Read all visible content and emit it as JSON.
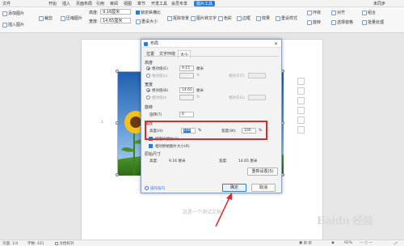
{
  "menubar": {
    "items": [
      "文件",
      "开始",
      "插入",
      "页面布局",
      "引用",
      "审阅",
      "视图",
      "章节",
      "开发工具",
      "会员专享",
      "图片工具"
    ],
    "active": "图片工具",
    "right_label": "未同步"
  },
  "ribbon": {
    "add_picture": "添加图片",
    "crop": "裁剪",
    "compress": "压缩图片",
    "insert_pic": "插入图片",
    "clear_bg": "抠除背景",
    "height_label": "高度:",
    "height_value": "9.16厘米",
    "width_label": "宽度:",
    "width_value": "14.65厘米",
    "lock_ratio": "锁定纵横比",
    "reset_size": "重设大小",
    "reset_style": "重设样式",
    "effects": "效果",
    "color": "色彩",
    "outline": "边框",
    "wrap": "环绕",
    "rotate": "旋转",
    "align": "对齐",
    "select": "选择窗格",
    "combine": "组合",
    "text_extract": "图片转文字",
    "batch": "批量处理",
    "more": "更多"
  },
  "document": {
    "caption": "这是一个测试文档"
  },
  "dialog": {
    "title": "布局",
    "tabs": [
      "位置",
      "文字环绕",
      "大小"
    ],
    "selected_tab": "大小",
    "height_section": "高度",
    "absolute_label": "绝对值(E)",
    "height_abs_value": "9.15",
    "unit_cm": "厘米",
    "relative_label": "相对值(L)",
    "relative_to": "相对于(T)",
    "percent": "%",
    "width_section": "宽度",
    "width_abs_label": "绝对值(B)",
    "width_abs_value": "14.65",
    "width_rel_label": "相对值(I)",
    "width_rel_to": "相对于(E)",
    "rotate_section": "旋转",
    "rotate_label": "旋转(T)",
    "rotate_value": "0",
    "scale_section": "缩放",
    "scale_height_label": "高度(H):",
    "scale_height_value": "100",
    "scale_width_label": "宽度(W):",
    "scale_width_value": "100",
    "lock_ratio_label": "锁定纵横比(A)",
    "relative_original_label": "相对原始图片大小(R)",
    "original_section": "原始尺寸",
    "orig_height_label": "高度:",
    "orig_height_value": "9.16 厘米",
    "orig_width_label": "宽度:",
    "orig_width_value": "14.65 厘米",
    "reset_button": "重新设置(S)",
    "tips_link": "操作技巧",
    "ok_button": "确定",
    "cancel_button": "取消"
  },
  "statusbar": {
    "page": "页面: 1/4",
    "words": "字数: 431",
    "spell": "文档校对",
    "zoom": "92%"
  },
  "watermark": "Baidu 经验",
  "colors": {
    "accent": "#2b79d8",
    "highlight_box": "#e02a2a"
  }
}
